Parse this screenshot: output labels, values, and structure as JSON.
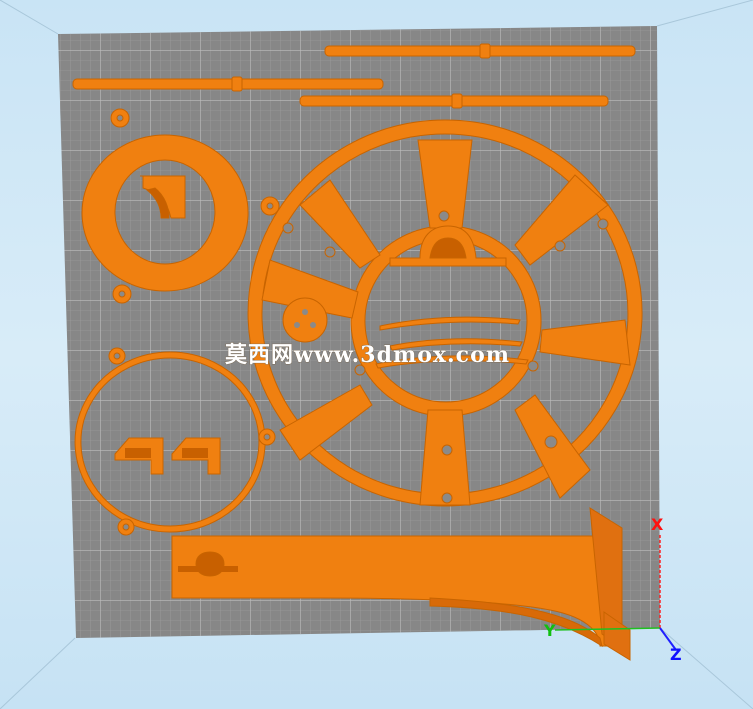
{
  "app": {
    "view": "3D print bed preview"
  },
  "colors": {
    "background": "#cfe6f6",
    "bed": "#8a8a8a",
    "grid_minor": "#9e9e9e",
    "grid_major": "#b8b8b8",
    "part": "#f08010",
    "part_shade": "#c86000",
    "axis_x": "#ff2020",
    "axis_y": "#20c020",
    "axis_z": "#2020ff"
  },
  "watermark": {
    "text": "莫西网www.3dmox.com"
  },
  "axes": {
    "x_label": "X",
    "y_label": "Y",
    "z_label": "Z"
  },
  "parts": [
    {
      "name": "rod-top-right"
    },
    {
      "name": "rod-top-left"
    },
    {
      "name": "rod-middle"
    },
    {
      "name": "motor-mount-ring"
    },
    {
      "name": "wheel-plate"
    },
    {
      "name": "fan-ring"
    },
    {
      "name": "curved-bracket"
    }
  ]
}
